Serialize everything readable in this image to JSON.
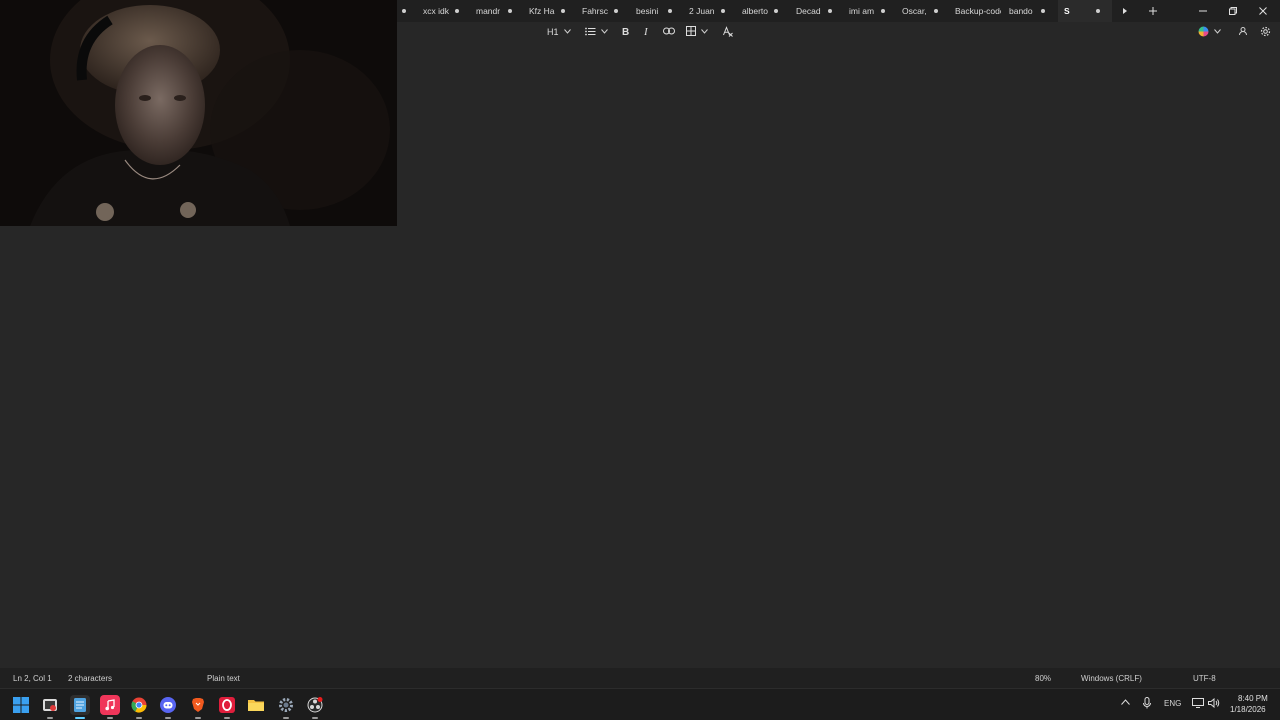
{
  "tabs": [
    {
      "label": "xcx idk"
    },
    {
      "label": "mandr"
    },
    {
      "label": "Kfz Ha"
    },
    {
      "label": "Fahrsc"
    },
    {
      "label": "besini"
    },
    {
      "label": "2 Juan"
    },
    {
      "label": "alberto"
    },
    {
      "label": "Decad"
    },
    {
      "label": "imi am"
    },
    {
      "label": "Oscar,"
    },
    {
      "label": "Backup-code"
    },
    {
      "label": "bando"
    },
    {
      "label": "S"
    }
  ],
  "toolbar": {
    "heading_label": "H1",
    "bold_label": "B",
    "italic_label": "I"
  },
  "statusbar": {
    "position": "Ln 2, Col 1",
    "characters": "2 characters",
    "format": "Plain text",
    "zoom": "80%",
    "line_endings": "Windows (CRLF)",
    "encoding": "UTF-8"
  },
  "tray": {
    "language": "ENG",
    "time": "8:40 PM",
    "date": "1/18/2026"
  },
  "taskbar_icons": [
    "windows-start-icon",
    "snipping-tool-icon",
    "notepad-icon",
    "music-icon",
    "chrome-icon",
    "discord-icon",
    "brave-icon",
    "opera-icon",
    "file-explorer-icon",
    "settings-icon",
    "obs-icon"
  ]
}
